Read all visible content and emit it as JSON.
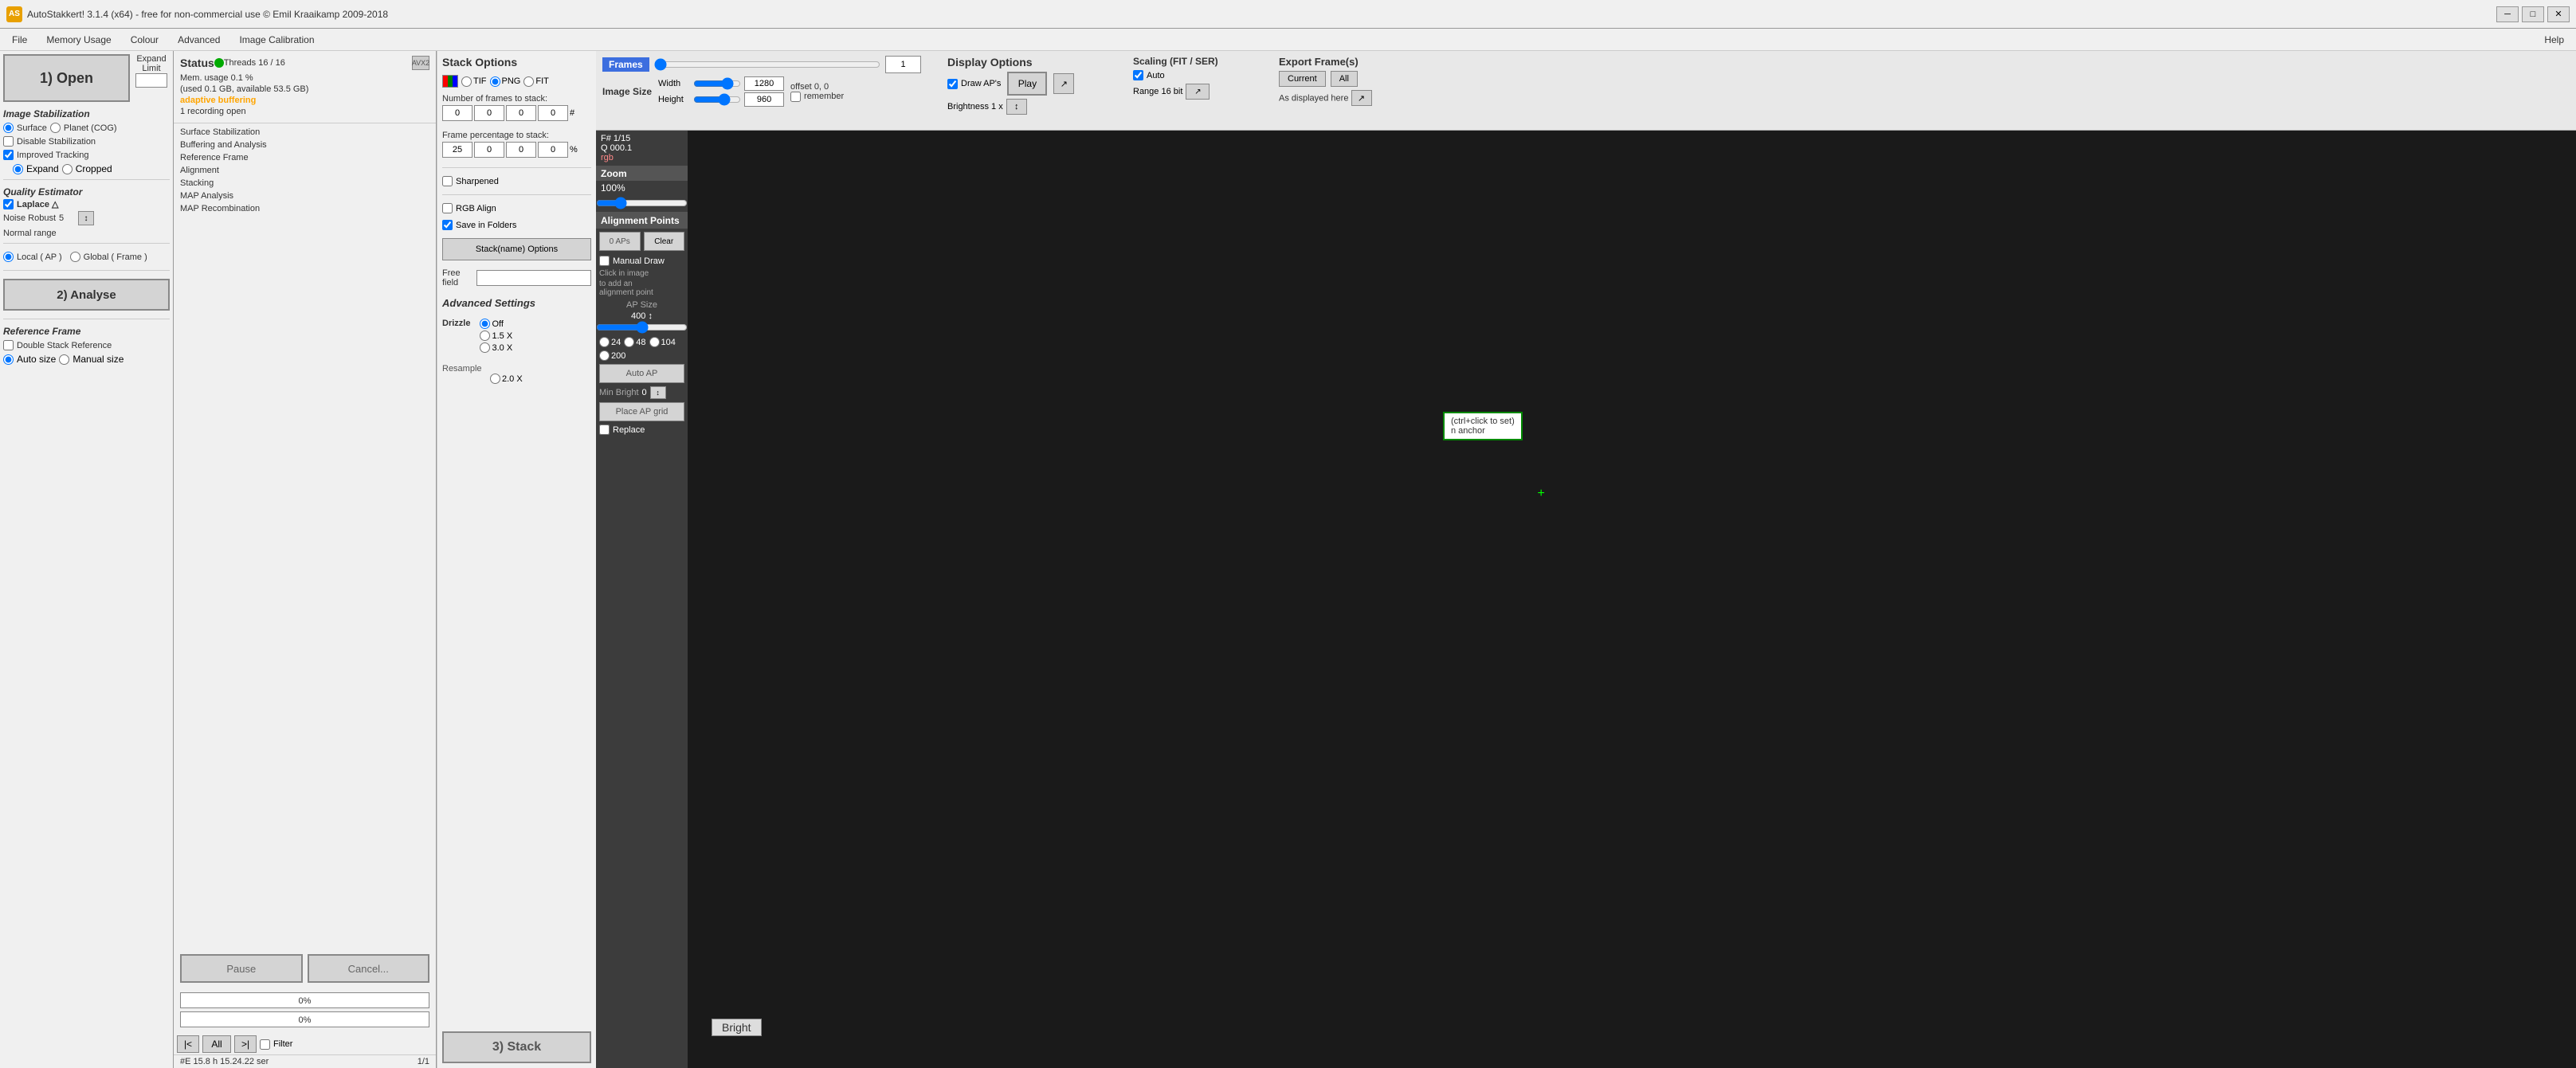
{
  "app": {
    "title": "AutoStakkert! 3.1.4 (x64) - free for non-commercial use © Emil Kraaikamp 2009-2018",
    "icon_label": "AS"
  },
  "menu": {
    "items": [
      "File",
      "Memory Usage",
      "Colour",
      "Advanced",
      "Image Calibration",
      "Help"
    ]
  },
  "left_panel": {
    "open_button": "1) Open",
    "expand_label": "Expand",
    "limit_label": "Limit",
    "expand_limit_value": "",
    "image_stabilization_label": "Image Stabilization",
    "surface_label": "Surface",
    "planet_label": "Planet (COG)",
    "disable_stabilization": "Disable Stabilization",
    "improved_tracking": "Improved Tracking",
    "expand_label2": "Expand",
    "cropped_label": "Cropped",
    "quality_estimator_label": "Quality Estimator",
    "laplace_label": "Laplace △",
    "noise_label": "Noise Robust",
    "noise_value": "5",
    "normal_range": "Normal range",
    "local_label": "Local",
    "local_ap": "( AP )",
    "global_label": "Global",
    "global_frame": "( Frame )",
    "analyse_button": "2) Analyse",
    "ref_frame_label": "Reference Frame",
    "double_stack": "Double Stack Reference",
    "auto_size": "Auto size",
    "manual_size": "Manual size"
  },
  "status": {
    "title": "Status",
    "threads": "Threads 16 / 16",
    "avx2": "AVX2",
    "mem_usage": "Mem. usage 0.1 %",
    "mem_detail": "(used 0.1 GB, available 53.5 GB)",
    "adaptive_buffering": "adaptive buffering",
    "recording": "1 recording open",
    "steps": [
      "Surface Stabilization",
      "Buffering and Analysis",
      "Reference Frame",
      "Alignment",
      "Stacking",
      "MAP Analysis",
      "MAP Recombination"
    ],
    "pause_btn": "Pause",
    "cancel_btn": "Cancel...",
    "progress1": "0%",
    "progress2": "0%",
    "bottom_left": "#E 15.8 h 15.24.22 ser",
    "bottom_right": "1/1"
  },
  "stack_options": {
    "title": "Stack Options",
    "format_label": "TIF",
    "format2": "PNG",
    "format3": "FIT",
    "frames_count_label": "Number of frames to stack:",
    "frames_values": [
      "0",
      "0",
      "0",
      "0"
    ],
    "pct_label": "Frame percentage to stack:",
    "pct_values": [
      "25",
      "0",
      "0",
      "0"
    ],
    "sharpened": "Sharpened",
    "rgb_align": "RGB Align",
    "save_in_folders": "Save in Folders",
    "stack_name_btn": "Stack(name) Options",
    "free_field_label": "Free field",
    "adv_settings": "Advanced Settings",
    "drizzle_label": "Drizzle",
    "drizzle_off": "Off",
    "drizzle_15x": "1.5 X",
    "drizzle_3x": "3.0 X",
    "resample_label": "Resample",
    "resample_2x": "2.0 X",
    "stack_btn": "3) Stack"
  },
  "frames_bar": {
    "label": "Frames",
    "frame_num": "1",
    "image_size_label": "Image Size",
    "width_label": "Width",
    "width_value": "1280",
    "height_label": "Height",
    "height_value": "960",
    "offset_label": "offset",
    "offset_value": "0, 0",
    "remember_label": "remember"
  },
  "display_options": {
    "title": "Display Options",
    "draw_aps": "Draw AP's",
    "brightness": "Brightness 1 x",
    "play_btn": "Play"
  },
  "scaling": {
    "title": "Scaling (FIT / SER)",
    "auto_label": "Auto",
    "range_label": "Range 16 bit",
    "as_displayed": "↗"
  },
  "export": {
    "title": "Export Frame(s)",
    "current_btn": "Current",
    "all_btn": "All",
    "as_displayed": "As displayed here",
    "arrow": "↗"
  },
  "image_info": {
    "frame_info": "F# 1/15",
    "q_info": "Q 000.1",
    "rgb": "rgb"
  },
  "zoom": {
    "label": "Zoom",
    "percent": "100%"
  },
  "alignment_points": {
    "title": "Alignment Points",
    "count": "0 APs",
    "clear": "Clear",
    "manual_draw": "Manual Draw",
    "click_hint1": "Click in image",
    "click_hint2": "to add an",
    "click_hint3": "alignment point",
    "ap_size_label": "AP Size",
    "ap_size_value": "400 ↕",
    "ap_24": "24",
    "ap_48": "48",
    "ap_104": "104",
    "ap_200": "200",
    "auto_ap": "Auto AP",
    "min_bright_label": "Min Bright",
    "min_bright_val": "0",
    "min_bright_arrow": "↕",
    "place_ap_grid": "Place AP grid",
    "replace": "Replace"
  },
  "ap_tooltip": {
    "line1": "(ctrl+click to set)",
    "line2": "n anchor"
  },
  "bright_badge": "Bright"
}
